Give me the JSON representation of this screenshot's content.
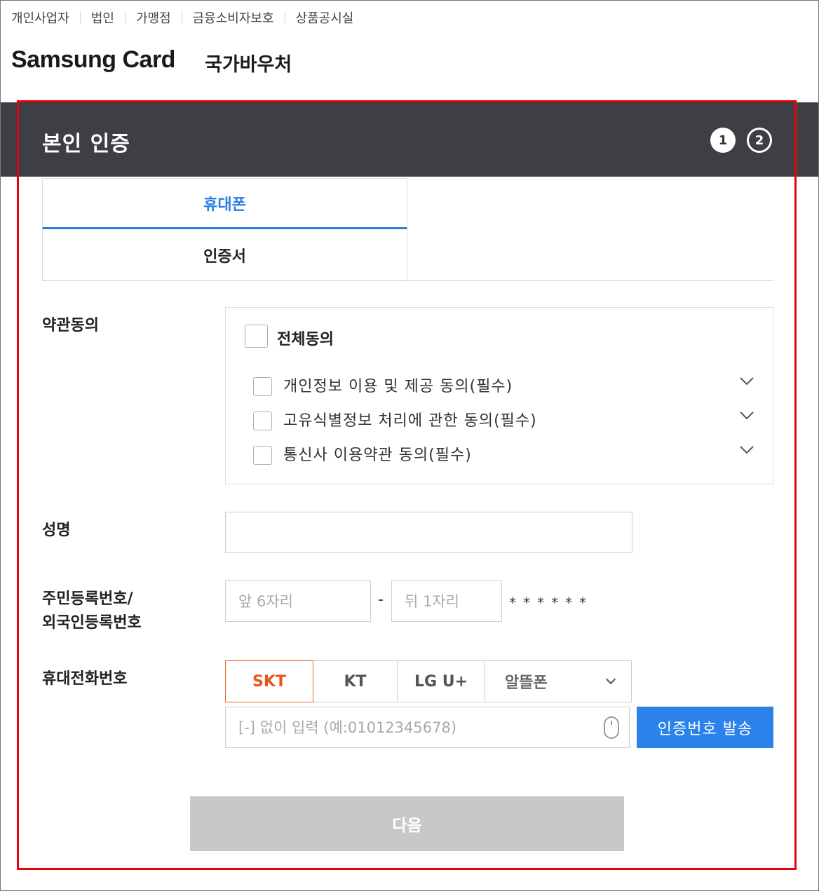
{
  "top_nav": {
    "items": [
      "개인사업자",
      "법인",
      "가맹점",
      "금융소비자보호",
      "상품공시실"
    ]
  },
  "brand": {
    "logo_text": "Samsung Card",
    "service_title": "국가바우처"
  },
  "header": {
    "title": "본인 인증",
    "steps": [
      "1",
      "2"
    ],
    "current_step": 1
  },
  "tabs": {
    "items": [
      {
        "label": "휴대폰",
        "active": true
      },
      {
        "label": "인증서",
        "active": false
      }
    ]
  },
  "form": {
    "terms": {
      "label": "약관동의",
      "agree_all": "전체동의",
      "items": [
        {
          "label": "개인정보 이용 및 제공 동의(필수)",
          "checked": false
        },
        {
          "label": "고유식별정보 처리에 관한 동의(필수)",
          "checked": false
        },
        {
          "label": "통신사 이용약관 동의(필수)",
          "checked": false
        }
      ]
    },
    "name": {
      "label": "성명",
      "value": "",
      "placeholder": ""
    },
    "resident_id": {
      "label_line1": "주민등록번호/",
      "label_line2": "외국인등록번호",
      "front_placeholder": "앞 6자리",
      "back_placeholder": "뒤 1자리",
      "separator": "-",
      "masked_digits": "******"
    },
    "phone": {
      "label": "휴대전화번호",
      "carriers": [
        "SKT",
        "KT",
        "LG U+"
      ],
      "selected_carrier": "SKT",
      "mvno_select": "알뜰폰",
      "number_placeholder": "[-] 없이 입력 (예:01012345678)",
      "send_button": "인증번호 발송"
    },
    "next_button": "다음"
  },
  "colors": {
    "header_bg": "#3d3f45",
    "accent_blue": "#2b82ea",
    "carrier_selected": "#e8541c",
    "highlight_border": "#e60012",
    "disabled_button": "#c8c8c8"
  },
  "icons": {
    "terms_expand": "chevron-down-icon",
    "mvno_dropdown": "chevron-down-icon",
    "input_helper": "mouse-icon"
  }
}
